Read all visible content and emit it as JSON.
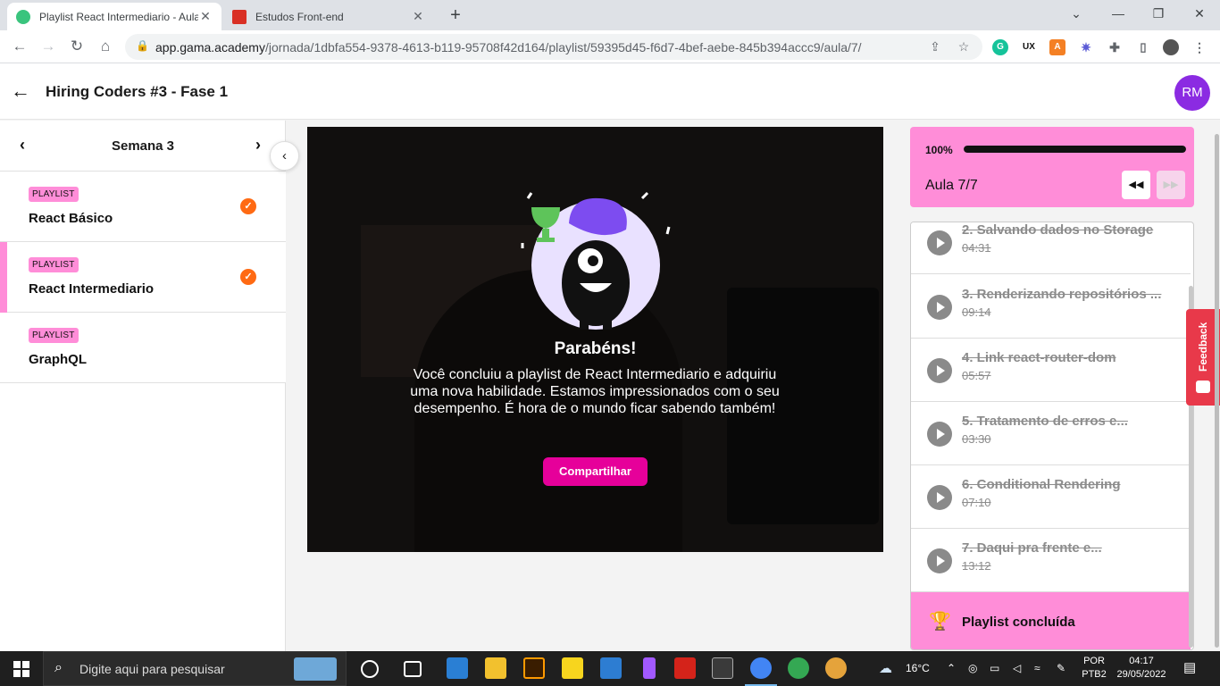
{
  "browser": {
    "tabs": [
      {
        "title": "Playlist React Intermediario - Aula",
        "favicon_color": "#3ac47d"
      },
      {
        "title": "Estudos Front-end",
        "favicon_color": "#d93025"
      }
    ],
    "url_host": "app.gama.academy",
    "url_path": "/jornada/1dbfa554-9378-4613-b119-95708f42d164/playlist/59395d45-f6d7-4bef-aebe-845b394accc9/aula/7/"
  },
  "header": {
    "title": "Hiring Coders #3 - Fase 1",
    "avatar_initials": "RM",
    "avatar_color": "#8b2be2"
  },
  "sidebar": {
    "week_title": "Semana 3",
    "playlists": [
      {
        "badge": "PLAYLIST",
        "name": "React Básico",
        "completed": true
      },
      {
        "badge": "PLAYLIST",
        "name": "React Intermediario",
        "completed": true
      },
      {
        "badge": "PLAYLIST",
        "name": "GraphQL",
        "completed": false
      }
    ]
  },
  "video": {
    "title": "Parabéns!",
    "message": "Você concluiu a playlist de React Intermediario e adquiriu uma nova habilidade. Estamos impressionados com o seu desempenho. É hora de o mundo ficar sabendo também!",
    "share_label": "Compartilhar"
  },
  "progress": {
    "percent_label": "100%",
    "percent_value": 100,
    "aula_label": "Aula 7/7",
    "accent": "#ff8dd8"
  },
  "lessons": [
    {
      "title": "2. Salvando dados no Storage",
      "duration": "04:31"
    },
    {
      "title": "3. Renderizando repositórios ...",
      "duration": "09:14"
    },
    {
      "title": "4. Link react-router-dom",
      "duration": "05:57"
    },
    {
      "title": "5. Tratamento de erros e...",
      "duration": "03:30"
    },
    {
      "title": "6. Conditional Rendering",
      "duration": "07:10"
    },
    {
      "title": "7. Daqui pra frente e...",
      "duration": "13:12"
    }
  ],
  "playlist_done_label": "Playlist concluída",
  "feedback_label": "Feedback",
  "taskbar": {
    "search_placeholder": "Digite aqui para pesquisar",
    "weather": "16°C",
    "lang_1": "POR",
    "lang_2": "PTB2",
    "time": "04:17",
    "date": "29/05/2022"
  }
}
